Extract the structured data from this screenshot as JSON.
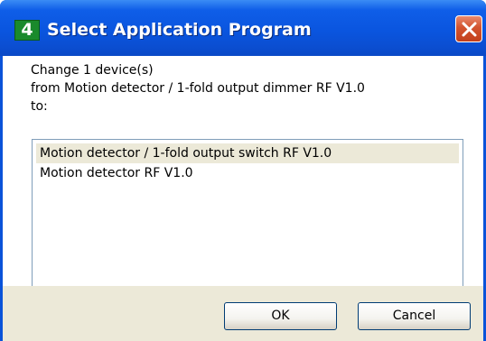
{
  "window": {
    "title": "Select Application Program",
    "app_icon_glyph": "4",
    "app_icon": "ets-app-icon",
    "close_icon": "close-x-icon",
    "accent_color": "#0a53d9",
    "close_color": "#d2532f"
  },
  "message": {
    "line1": "Change 1 device(s)",
    "line2": "from Motion detector / 1-fold output dimmer RF V1.0",
    "line3": "to:"
  },
  "list": {
    "items": [
      {
        "label": "Motion detector / 1-fold output switch RF V1.0",
        "selected": true
      },
      {
        "label": "Motion detector RF V1.0",
        "selected": false
      }
    ]
  },
  "buttons": {
    "ok": "OK",
    "cancel": "Cancel"
  }
}
